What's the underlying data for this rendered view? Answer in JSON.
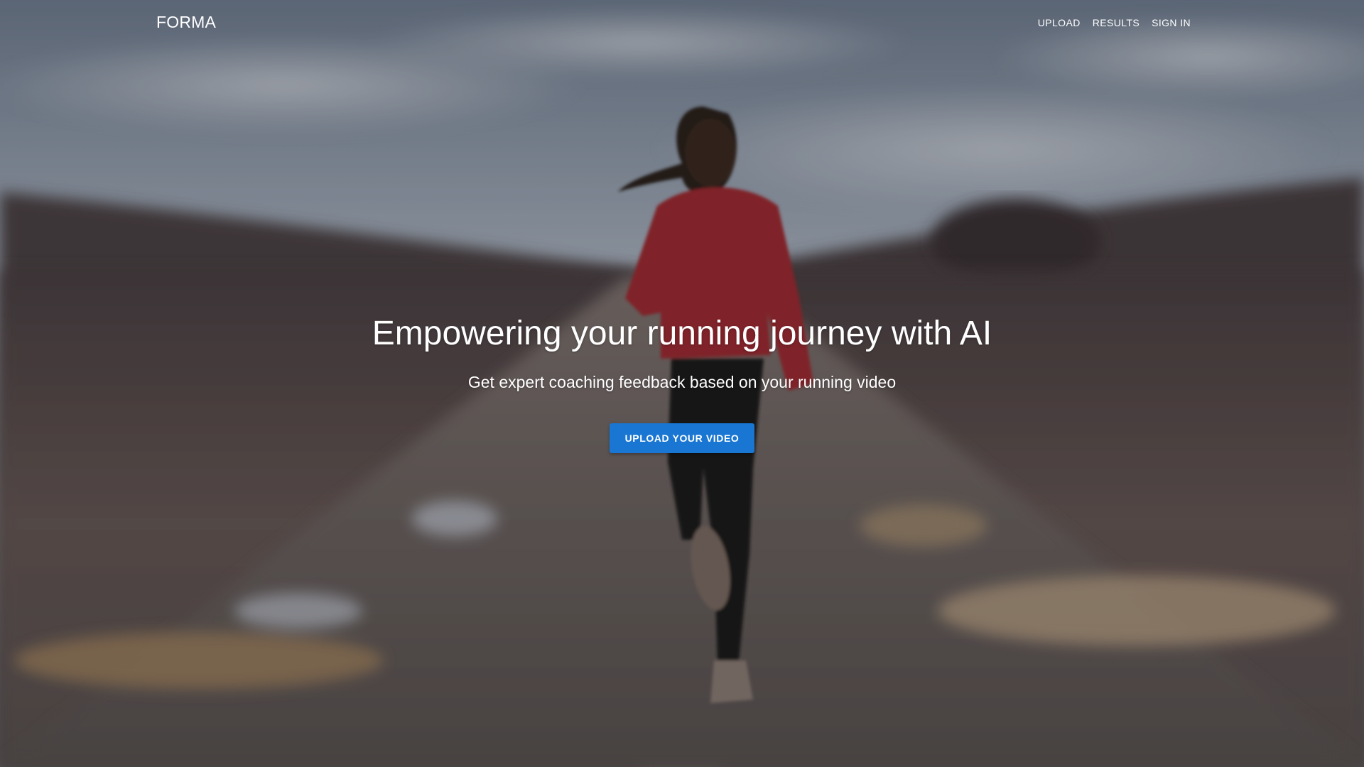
{
  "brand": {
    "name": "FORMA"
  },
  "nav": {
    "items": [
      {
        "label": "UPLOAD"
      },
      {
        "label": "RESULTS"
      },
      {
        "label": "SIGN IN"
      }
    ]
  },
  "hero": {
    "headline": "Empowering your running journey with AI",
    "subheadline": "Get expert coaching feedback based on your running video",
    "cta_label": "UPLOAD YOUR VIDEO",
    "background_image": "runner-on-road-photo"
  },
  "colors": {
    "primary": "#1976d2",
    "text": "#ffffff"
  }
}
